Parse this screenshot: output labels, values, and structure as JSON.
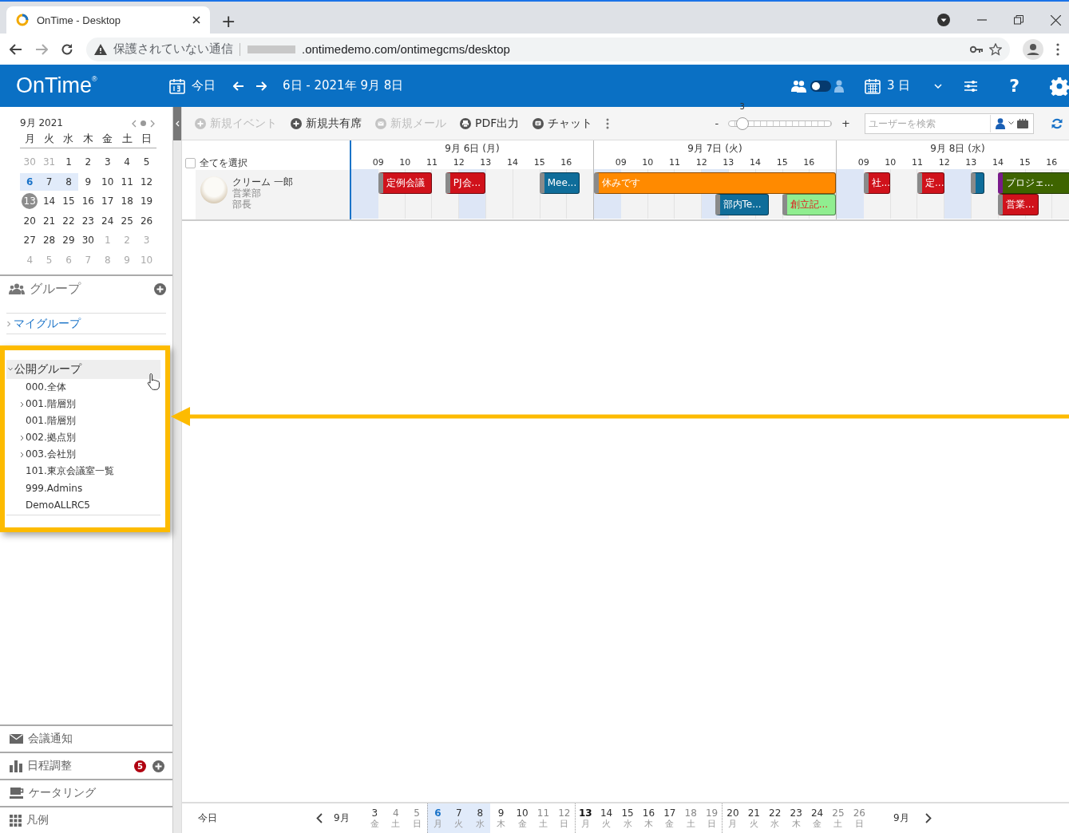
{
  "browser": {
    "tab_title": "OnTime - Desktop",
    "new_tab": "+",
    "security_label": "保護されていない通信",
    "url": ".ontimedemo.com/ontimegcms/desktop"
  },
  "header": {
    "logo": "OnTime",
    "logo_mark": "®",
    "today": "今日",
    "range": "6日 - 2021年 9月 8日",
    "person_view": false,
    "view_days": "3 日",
    "help": "?"
  },
  "mini_calendar": {
    "title": "9月 2021",
    "weekdays": [
      "月",
      "火",
      "水",
      "木",
      "金",
      "土",
      "日"
    ],
    "weeks": [
      [
        {
          "day": "30",
          "other_month": true,
          "selected": false,
          "today": false,
          "focus": false
        },
        {
          "day": "31",
          "other_month": true,
          "selected": false,
          "today": false,
          "focus": false
        },
        {
          "day": "1",
          "other_month": false,
          "selected": false,
          "today": false,
          "focus": false
        },
        {
          "day": "2",
          "other_month": false,
          "selected": false,
          "today": false,
          "focus": false
        },
        {
          "day": "3",
          "other_month": false,
          "selected": false,
          "today": false,
          "focus": false
        },
        {
          "day": "4",
          "other_month": false,
          "selected": false,
          "today": false,
          "focus": false
        },
        {
          "day": "5",
          "other_month": false,
          "selected": false,
          "today": false,
          "focus": false
        }
      ],
      [
        {
          "day": "6",
          "other_month": false,
          "selected": true,
          "today": false,
          "focus": true
        },
        {
          "day": "7",
          "other_month": false,
          "selected": true,
          "today": false,
          "focus": false
        },
        {
          "day": "8",
          "other_month": false,
          "selected": true,
          "today": false,
          "focus": false
        },
        {
          "day": "9",
          "other_month": false,
          "selected": false,
          "today": false,
          "focus": false
        },
        {
          "day": "10",
          "other_month": false,
          "selected": false,
          "today": false,
          "focus": false
        },
        {
          "day": "11",
          "other_month": false,
          "selected": false,
          "today": false,
          "focus": false
        },
        {
          "day": "12",
          "other_month": false,
          "selected": false,
          "today": false,
          "focus": false
        }
      ],
      [
        {
          "day": "13",
          "other_month": false,
          "selected": false,
          "today": true,
          "focus": false
        },
        {
          "day": "14",
          "other_month": false,
          "selected": false,
          "today": false,
          "focus": false
        },
        {
          "day": "15",
          "other_month": false,
          "selected": false,
          "today": false,
          "focus": false
        },
        {
          "day": "16",
          "other_month": false,
          "selected": false,
          "today": false,
          "focus": false
        },
        {
          "day": "17",
          "other_month": false,
          "selected": false,
          "today": false,
          "focus": false
        },
        {
          "day": "18",
          "other_month": false,
          "selected": false,
          "today": false,
          "focus": false
        },
        {
          "day": "19",
          "other_month": false,
          "selected": false,
          "today": false,
          "focus": false
        }
      ],
      [
        {
          "day": "20",
          "other_month": false,
          "selected": false,
          "today": false,
          "focus": false
        },
        {
          "day": "21",
          "other_month": false,
          "selected": false,
          "today": false,
          "focus": false
        },
        {
          "day": "22",
          "other_month": false,
          "selected": false,
          "today": false,
          "focus": false
        },
        {
          "day": "23",
          "other_month": false,
          "selected": false,
          "today": false,
          "focus": false
        },
        {
          "day": "24",
          "other_month": false,
          "selected": false,
          "today": false,
          "focus": false
        },
        {
          "day": "25",
          "other_month": false,
          "selected": false,
          "today": false,
          "focus": false
        },
        {
          "day": "26",
          "other_month": false,
          "selected": false,
          "today": false,
          "focus": false
        }
      ],
      [
        {
          "day": "27",
          "other_month": false,
          "selected": false,
          "today": false,
          "focus": false
        },
        {
          "day": "28",
          "other_month": false,
          "selected": false,
          "today": false,
          "focus": false
        },
        {
          "day": "29",
          "other_month": false,
          "selected": false,
          "today": false,
          "focus": false
        },
        {
          "day": "30",
          "other_month": false,
          "selected": false,
          "today": false,
          "focus": false
        },
        {
          "day": "1",
          "other_month": true,
          "selected": false,
          "today": false,
          "focus": false
        },
        {
          "day": "2",
          "other_month": true,
          "selected": false,
          "today": false,
          "focus": false
        },
        {
          "day": "3",
          "other_month": true,
          "selected": false,
          "today": false,
          "focus": false
        }
      ],
      [
        {
          "day": "4",
          "other_month": true,
          "selected": false,
          "today": false,
          "focus": false
        },
        {
          "day": "5",
          "other_month": true,
          "selected": false,
          "today": false,
          "focus": false
        },
        {
          "day": "6",
          "other_month": true,
          "selected": false,
          "today": false,
          "focus": false
        },
        {
          "day": "7",
          "other_month": true,
          "selected": false,
          "today": false,
          "focus": false
        },
        {
          "day": "8",
          "other_month": true,
          "selected": false,
          "today": false,
          "focus": false
        },
        {
          "day": "9",
          "other_month": true,
          "selected": false,
          "today": false,
          "focus": false
        },
        {
          "day": "10",
          "other_month": true,
          "selected": false,
          "today": false,
          "focus": false
        }
      ]
    ]
  },
  "groups": {
    "title": "グループ",
    "items": [
      {
        "label": "マイグループ",
        "expanded": false
      }
    ],
    "public": {
      "label": "公開グループ",
      "expanded": true,
      "children": [
        {
          "label": "000.全体",
          "expandable": false
        },
        {
          "label": "001.階層別",
          "expandable": true
        },
        {
          "label": "001.階層別",
          "expandable": false
        },
        {
          "label": "002.拠点別",
          "expandable": true
        },
        {
          "label": "003.会社別",
          "expandable": true
        },
        {
          "label": "101.東京会議室一覧",
          "expandable": false
        },
        {
          "label": "999.Admins",
          "expandable": false
        },
        {
          "label": "DemoALLRC5",
          "expandable": false
        }
      ]
    }
  },
  "sidebar_nav": [
    {
      "kind": "mail",
      "label": "会議通知",
      "add": false
    },
    {
      "kind": "chart",
      "label": "日程調整",
      "badge": "5",
      "add": true
    },
    {
      "kind": "cup",
      "label": "ケータリング",
      "add": false
    },
    {
      "kind": "grid",
      "label": "凡例",
      "add": false
    }
  ],
  "toolbar": {
    "actions": [
      {
        "kind": "plus",
        "label": "新規イベント",
        "disabled": true
      },
      {
        "kind": "plus",
        "label": "新規共有席",
        "disabled": false
      },
      {
        "kind": "mail",
        "label": "新規メール",
        "disabled": true
      },
      {
        "kind": "print",
        "label": "PDF出力",
        "disabled": false
      },
      {
        "kind": "chat",
        "label": "チャット",
        "disabled": false
      }
    ],
    "zoom": {
      "minus": "-",
      "plus": "+",
      "value": "3",
      "level": 0.13
    },
    "search": {
      "placeholder": "ユーザーを検索"
    }
  },
  "timeline": {
    "select_all": {
      "label": "全てを選択",
      "checked": false
    },
    "person": {
      "name": "クリーム 一郎",
      "department": "営業部",
      "title": "部長"
    },
    "days": [
      {
        "label": "9月 6日 (月)",
        "hours": [
          "09",
          "10",
          "11",
          "12",
          "13",
          "14",
          "15",
          "16"
        ],
        "events": [
          {
            "title": "定例会議",
            "color": "#d0121b",
            "kind": "standard"
          },
          {
            "title": "PJ会...",
            "color": "#d0121b",
            "kind": "standard"
          },
          {
            "title": "Mee...",
            "color": "#0f6d9a",
            "kind": "standard"
          }
        ]
      },
      {
        "label": "9月 7日 (火)",
        "hours": [
          "09",
          "10",
          "11",
          "12",
          "13",
          "14",
          "15",
          "16"
        ],
        "events": [
          {
            "title": "休みです",
            "color": "#ff8a00",
            "kind": "standard"
          },
          {
            "title": "部内Te...",
            "color": "#0f6d9a",
            "kind": "standard"
          },
          {
            "title": "創立記...",
            "color": "#90ee90",
            "kind": "anniversary"
          }
        ]
      },
      {
        "label": "9月 8日 (水)",
        "hours": [
          "09",
          "10",
          "11",
          "12",
          "13",
          "14",
          "15",
          "16"
        ],
        "events": [
          {
            "title": "社...",
            "color": "#d0121b",
            "kind": "standard"
          },
          {
            "title": "定...",
            "color": "#d0121b",
            "kind": "standard"
          },
          {
            "color": "#0f6d9a",
            "kind": "standard"
          },
          {
            "title": "プロジェ...",
            "color": "#3e6400",
            "kind": "project"
          },
          {
            "title": "営業...",
            "color": "#d0121b",
            "kind": "standard"
          }
        ]
      }
    ]
  },
  "date_strip": {
    "today": "今日",
    "prev_month": "9月",
    "next_month": "9月",
    "dates": [
      {
        "day": "3",
        "weekday": "金",
        "selected": false,
        "today": false,
        "focus": false,
        "weekend": false,
        "week_start": false
      },
      {
        "day": "4",
        "weekday": "土",
        "selected": false,
        "today": false,
        "focus": false,
        "weekend": true,
        "week_start": false
      },
      {
        "day": "5",
        "weekday": "日",
        "selected": false,
        "today": false,
        "focus": false,
        "weekend": true,
        "week_start": false
      },
      {
        "day": "6",
        "weekday": "月",
        "selected": true,
        "today": false,
        "focus": true,
        "weekend": false,
        "week_start": true
      },
      {
        "day": "7",
        "weekday": "火",
        "selected": true,
        "today": false,
        "focus": false,
        "weekend": false,
        "week_start": false
      },
      {
        "day": "8",
        "weekday": "水",
        "selected": true,
        "today": false,
        "focus": false,
        "weekend": false,
        "week_start": false
      },
      {
        "day": "9",
        "weekday": "木",
        "selected": false,
        "today": false,
        "focus": false,
        "weekend": false,
        "week_start": false
      },
      {
        "day": "10",
        "weekday": "金",
        "selected": false,
        "today": false,
        "focus": false,
        "weekend": false,
        "week_start": false
      },
      {
        "day": "11",
        "weekday": "土",
        "selected": false,
        "today": false,
        "focus": false,
        "weekend": true,
        "week_start": false
      },
      {
        "day": "12",
        "weekday": "日",
        "selected": false,
        "today": false,
        "focus": false,
        "weekend": true,
        "week_start": false
      },
      {
        "day": "13",
        "weekday": "月",
        "selected": false,
        "today": true,
        "focus": false,
        "weekend": false,
        "week_start": true
      },
      {
        "day": "14",
        "weekday": "火",
        "selected": false,
        "today": false,
        "focus": false,
        "weekend": false,
        "week_start": false
      },
      {
        "day": "15",
        "weekday": "水",
        "selected": false,
        "today": false,
        "focus": false,
        "weekend": false,
        "week_start": false
      },
      {
        "day": "16",
        "weekday": "木",
        "selected": false,
        "today": false,
        "focus": false,
        "weekend": false,
        "week_start": false
      },
      {
        "day": "17",
        "weekday": "金",
        "selected": false,
        "today": false,
        "focus": false,
        "weekend": false,
        "week_start": false
      },
      {
        "day": "18",
        "weekday": "土",
        "selected": false,
        "today": false,
        "focus": false,
        "weekend": true,
        "week_start": false
      },
      {
        "day": "19",
        "weekday": "日",
        "selected": false,
        "today": false,
        "focus": false,
        "weekend": true,
        "week_start": false
      },
      {
        "day": "20",
        "weekday": "月",
        "selected": false,
        "today": false,
        "focus": false,
        "weekend": false,
        "week_start": true
      },
      {
        "day": "21",
        "weekday": "火",
        "selected": false,
        "today": false,
        "focus": false,
        "weekend": false,
        "week_start": false
      },
      {
        "day": "22",
        "weekday": "水",
        "selected": false,
        "today": false,
        "focus": false,
        "weekend": false,
        "week_start": false
      },
      {
        "day": "23",
        "weekday": "木",
        "selected": false,
        "today": false,
        "focus": false,
        "weekend": false,
        "week_start": false
      },
      {
        "day": "24",
        "weekday": "金",
        "selected": false,
        "today": false,
        "focus": false,
        "weekend": false,
        "week_start": false
      },
      {
        "day": "25",
        "weekday": "土",
        "selected": false,
        "today": false,
        "focus": false,
        "weekend": true,
        "week_start": false
      },
      {
        "day": "26",
        "weekday": "日",
        "selected": false,
        "today": false,
        "focus": false,
        "weekend": true,
        "week_start": false
      }
    ]
  }
}
